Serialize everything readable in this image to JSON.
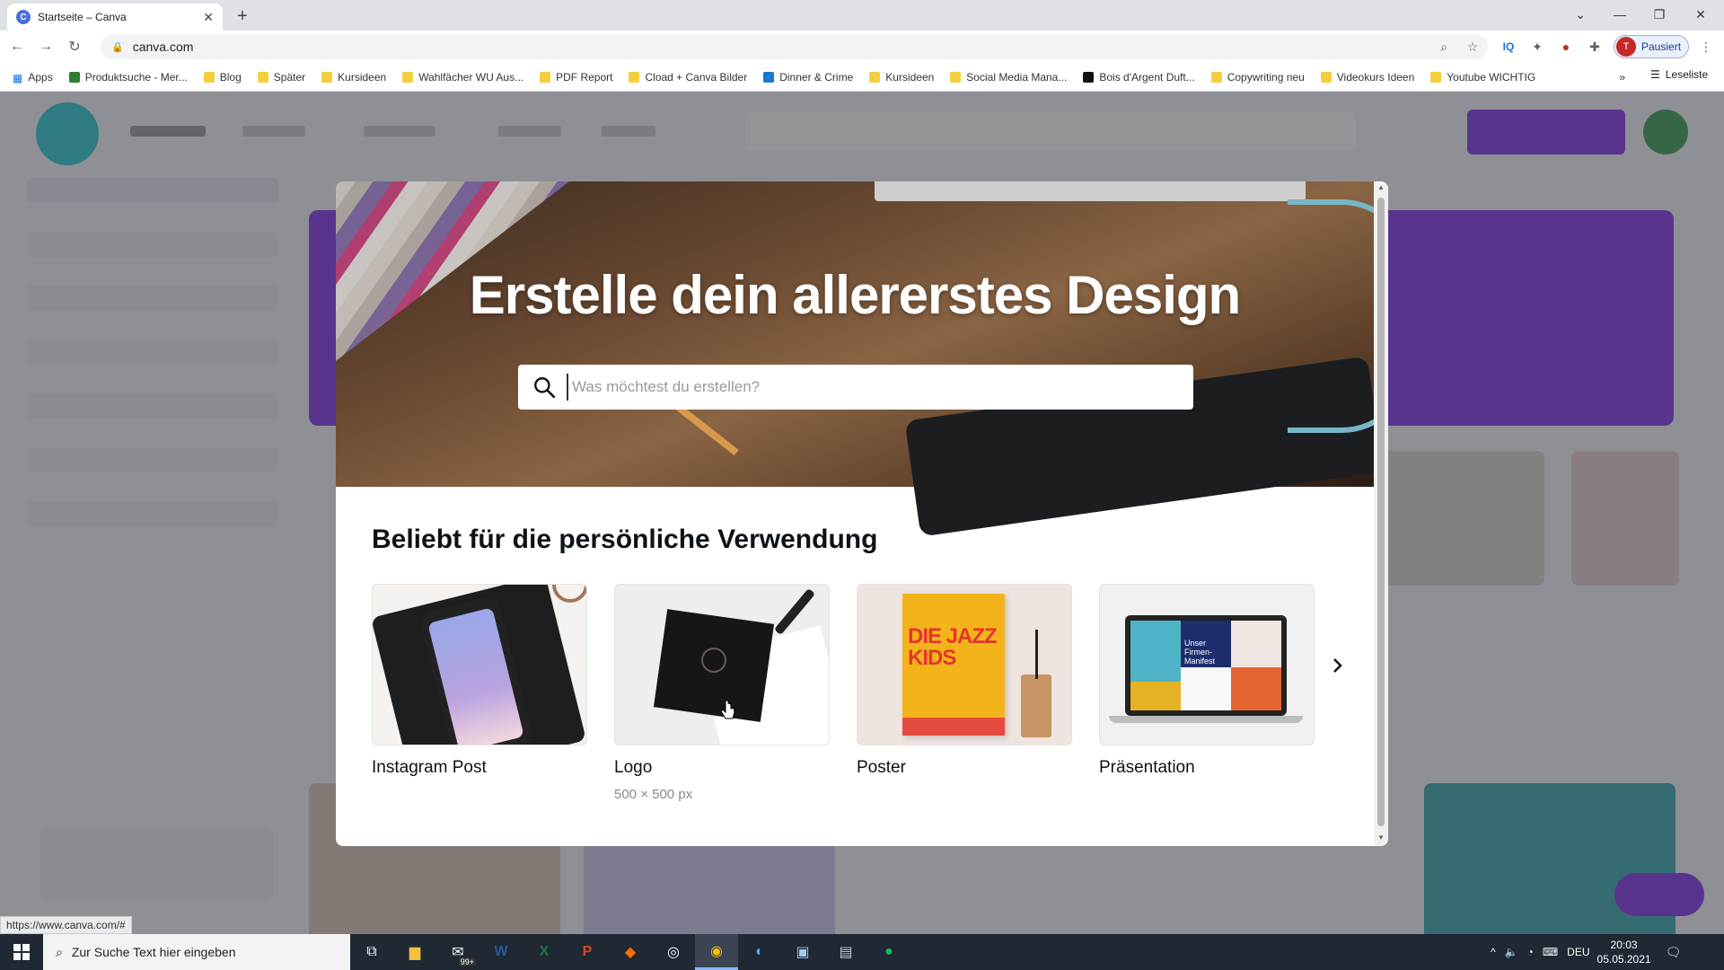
{
  "browser": {
    "tab_title": "Startseite – Canva",
    "url": "canva.com",
    "profile_label": "Pausiert",
    "profile_initial": "T",
    "status_url": "https://www.canva.com/#",
    "reading_list": "Leseliste",
    "bookmarks": [
      {
        "label": "Apps",
        "type": "apps"
      },
      {
        "label": "Produktsuche - Mer...",
        "type": "green"
      },
      {
        "label": "Blog",
        "type": "folder"
      },
      {
        "label": "Später",
        "type": "folder"
      },
      {
        "label": "Kursideen",
        "type": "folder"
      },
      {
        "label": "Wahlfächer WU Aus...",
        "type": "folder"
      },
      {
        "label": "PDF Report",
        "type": "folder"
      },
      {
        "label": "Cload + Canva Bilder",
        "type": "folder"
      },
      {
        "label": "Dinner & Crime",
        "type": "blue"
      },
      {
        "label": "Kursideen",
        "type": "folder"
      },
      {
        "label": "Social Media Mana...",
        "type": "folder"
      },
      {
        "label": "Bois d'Argent Duft...",
        "type": "black"
      },
      {
        "label": "Copywriting neu",
        "type": "folder"
      },
      {
        "label": "Videokurs Ideen",
        "type": "folder"
      },
      {
        "label": "Youtube WICHTIG",
        "type": "folder"
      }
    ]
  },
  "modal": {
    "hero_title": "Erstelle dein allererstes Design",
    "search_placeholder": "Was möchtest du erstellen?",
    "section_title": "Beliebt für die persönliche Verwendung",
    "cards": [
      {
        "label": "Instagram Post",
        "sub": ""
      },
      {
        "label": "Logo",
        "sub": "500 × 500 px"
      },
      {
        "label": "Poster",
        "sub": ""
      },
      {
        "label": "Präsentation",
        "sub": ""
      }
    ],
    "poster_text": "DIE JAZZ KIDS",
    "presentation_text": "Unser Firmen-Manifest"
  },
  "taskbar": {
    "search_placeholder": "Zur Suche Text hier eingeben",
    "badge": "99+",
    "language": "DEU",
    "time": "20:03",
    "date": "05.05.2021"
  },
  "colors": {
    "canva_purple": "#7d2ae8",
    "canva_teal": "#1dc8cf",
    "taskbar": "#1f2833"
  }
}
